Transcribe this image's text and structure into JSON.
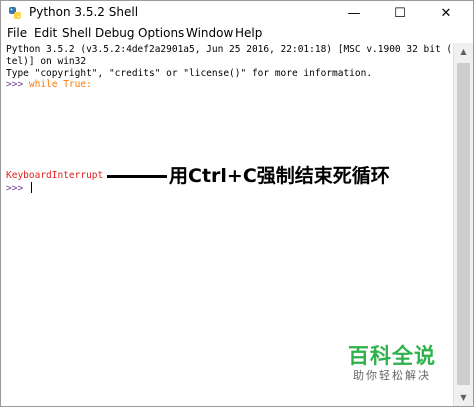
{
  "window": {
    "title": "Python 3.5.2 Shell",
    "controls": {
      "minimize": "—",
      "maximize": "☐",
      "close": "✕"
    }
  },
  "menu": [
    {
      "label": "File"
    },
    {
      "label": "Edit"
    },
    {
      "label": "Shell"
    },
    {
      "label": "Debug"
    },
    {
      "label": "Options"
    },
    {
      "label": "Window"
    },
    {
      "label": "Help"
    }
  ],
  "shell": {
    "line1": "Python 3.5.2 (v3.5.2:4def2a2901a5, Jun 25 2016, 22:01:18) [MSC v.1900 32 bit (In",
    "line2": "tel)] on win32",
    "line3": "Type \"copyright\", \"credits\" or \"license()\" for more information.",
    "prompt": ">>> ",
    "code": "while True:",
    "error": "KeyboardInterrupt",
    "prompt2": ">>> "
  },
  "annotation": {
    "text": "用Ctrl+C强制结束死循环"
  },
  "watermark": {
    "main": "百科全说",
    "sub": "助你轻松解决"
  }
}
